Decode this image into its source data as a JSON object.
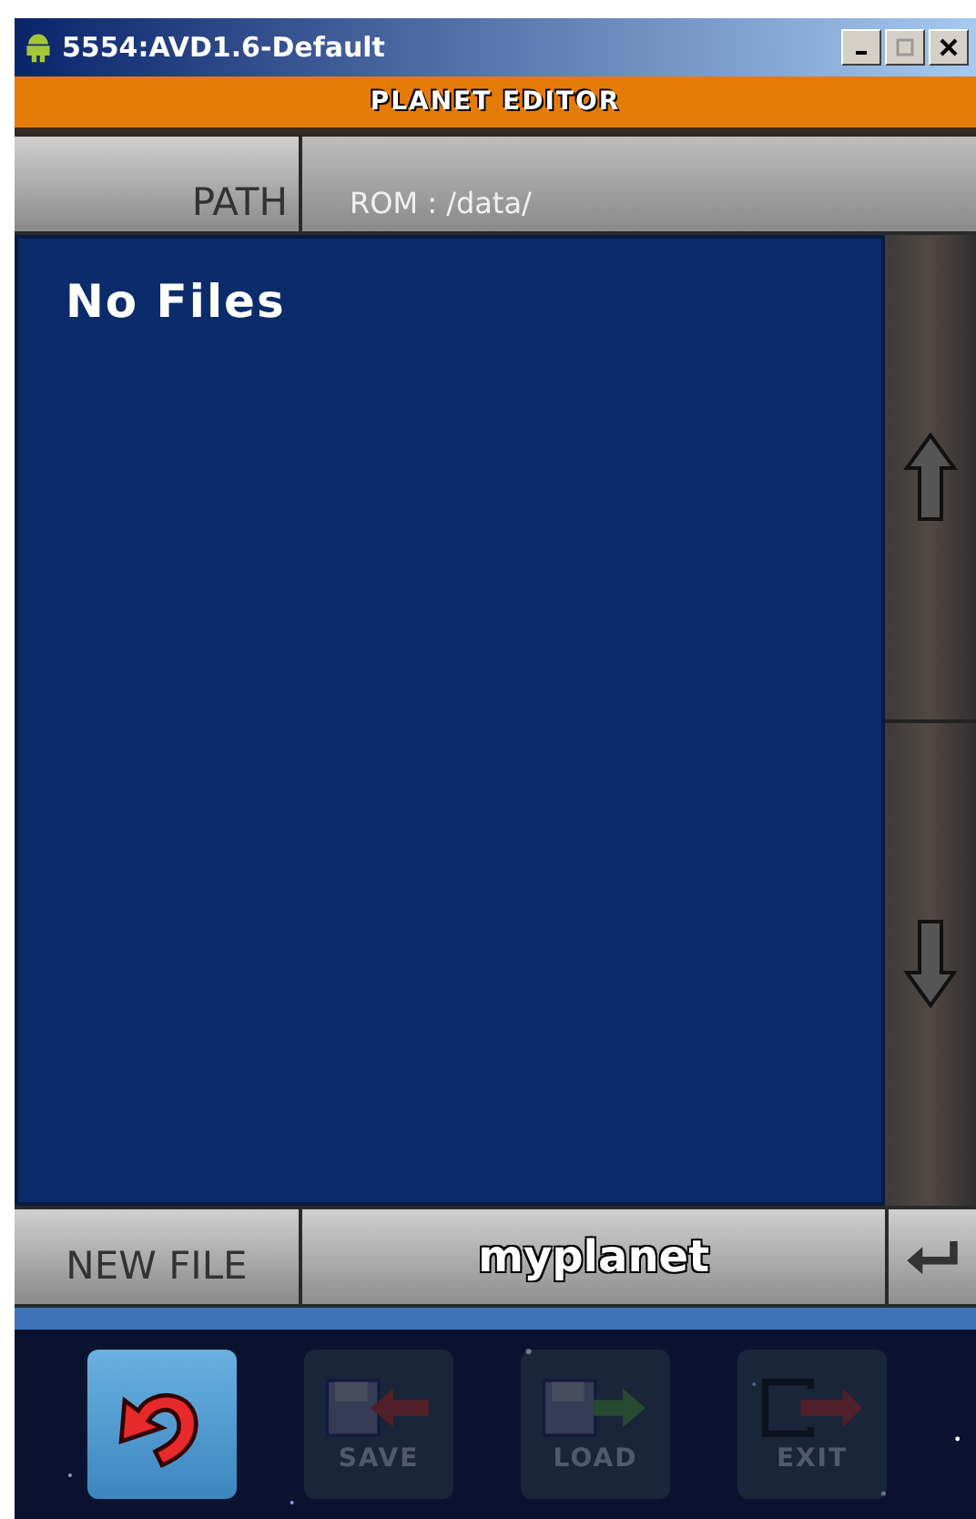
{
  "window": {
    "title": "5554:AVD1.6-Default"
  },
  "header": {
    "title": "PLANET EDITOR"
  },
  "path": {
    "label": "PATH",
    "value": "ROM : /data/"
  },
  "file_list": {
    "empty_text": "No Files"
  },
  "new_file": {
    "label": "NEW FILE",
    "value": "myplanet"
  },
  "toolbar": [
    {
      "kind": "back",
      "disabled": false
    },
    {
      "kind": "save",
      "label": "SAVE",
      "disabled": true
    },
    {
      "kind": "load",
      "label": "LOAD",
      "disabled": true
    },
    {
      "kind": "exit",
      "label": "EXIT",
      "disabled": true
    }
  ]
}
